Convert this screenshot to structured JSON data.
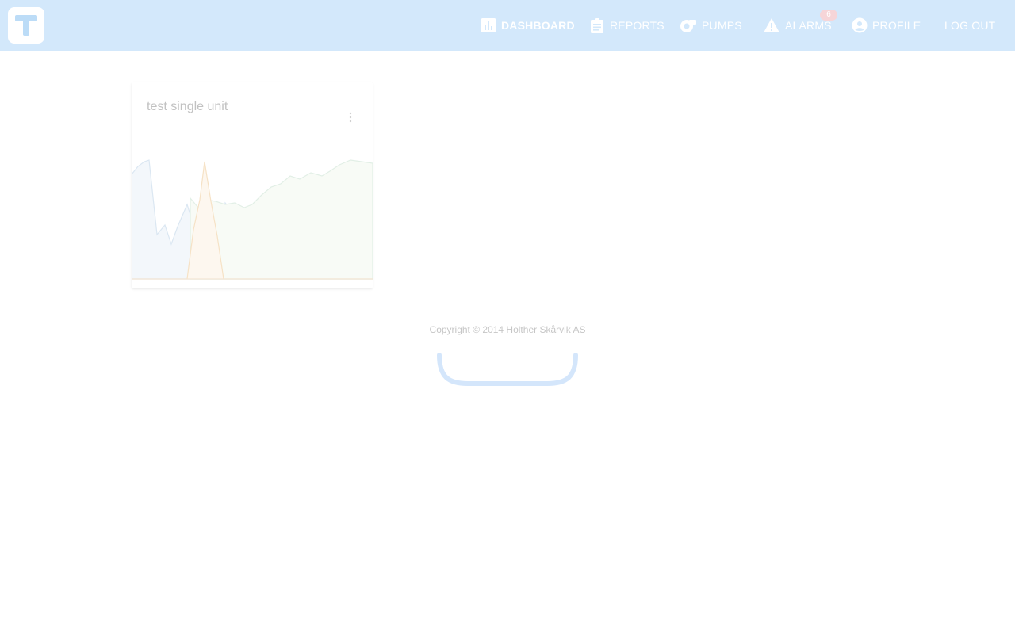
{
  "header": {
    "logo_letter": "T",
    "nav": [
      {
        "id": "dashboard",
        "label": "DASHBOARD",
        "icon": "bar-chart-icon",
        "active": true
      },
      {
        "id": "reports",
        "label": "REPORTS",
        "icon": "clipboard-icon",
        "active": false
      },
      {
        "id": "pumps",
        "label": "PUMPS",
        "icon": "pump-icon",
        "active": false
      },
      {
        "id": "alarms",
        "label": "ALARMS",
        "icon": "warning-icon",
        "active": false,
        "badge": "6"
      },
      {
        "id": "profile",
        "label": "PROFILE",
        "icon": "account-circle-icon",
        "active": false
      },
      {
        "id": "logout",
        "label": "LOG OUT",
        "icon": "",
        "active": false
      }
    ]
  },
  "card": {
    "title": "test single unit",
    "menu_icon": "more-vertical-icon"
  },
  "footer": {
    "copyright": "Copyright © 2014 Holther Skårvik AS"
  },
  "colors": {
    "header_bg": "#d3e8fb",
    "badge_bg": "#f6d5d8",
    "series_blue": "#dbe7f2",
    "series_green": "#e2efe6",
    "series_orange": "#f6e2c6",
    "spinner": "#d4e6fb"
  }
}
